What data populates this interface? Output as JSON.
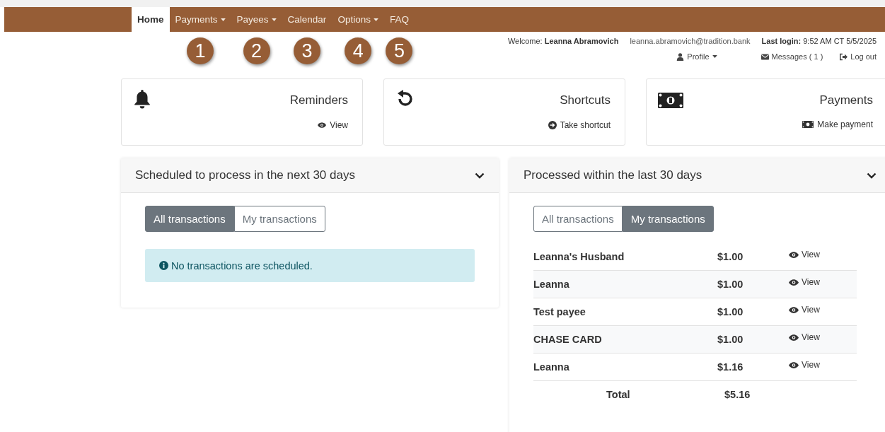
{
  "nav": {
    "items": [
      {
        "label": "Home",
        "selected": true,
        "dropdown": false
      },
      {
        "label": "Payments",
        "selected": false,
        "dropdown": true,
        "callout": "1"
      },
      {
        "label": "Payees",
        "selected": false,
        "dropdown": true,
        "callout": "2"
      },
      {
        "label": "Calendar",
        "selected": false,
        "dropdown": false,
        "callout": "3"
      },
      {
        "label": "Options",
        "selected": false,
        "dropdown": true,
        "callout": "4"
      },
      {
        "label": "FAQ",
        "selected": false,
        "dropdown": false,
        "callout": "5"
      }
    ]
  },
  "user": {
    "welcome_label": "Welcome:",
    "name": "Leanna Abramovich",
    "email": "leanna.abramovich@tradition.bank",
    "last_login_label": "Last login:",
    "last_login": "9:52 AM CT 5/5/2025",
    "links": [
      {
        "kind": "profile",
        "label": "Profile",
        "dropdown": true
      },
      {
        "kind": "messages",
        "label": "Messages ( 1 )",
        "dropdown": false
      },
      {
        "kind": "logout",
        "label": "Log out",
        "dropdown": false
      }
    ]
  },
  "cards": [
    {
      "kind": "reminders",
      "title": "Reminders",
      "link": "View"
    },
    {
      "kind": "shortcuts",
      "title": "Shortcuts",
      "link": "Take shortcut"
    },
    {
      "kind": "payments",
      "title": "Payments",
      "link": "Make payment"
    }
  ],
  "panels": [
    {
      "title": "Scheduled to process in the next 30 days",
      "expanded": true,
      "toggles": [
        {
          "label": "All transactions",
          "selected": true
        },
        {
          "label": "My transactions",
          "selected": false
        }
      ],
      "alert": "No transactions are scheduled."
    },
    {
      "title": "Processed within the last 30 days",
      "expanded": true,
      "toggles": [
        {
          "label": "All transactions",
          "selected": false
        },
        {
          "label": "My transactions",
          "selected": true
        }
      ],
      "rows": [
        {
          "payee": "Leanna's Husband",
          "amount": "$1.00",
          "action": "View"
        },
        {
          "payee": "Leanna",
          "amount": "$1.00",
          "action": "View"
        },
        {
          "payee": "Test payee",
          "amount": "$1.00",
          "action": "View"
        },
        {
          "payee": "CHASE CARD",
          "amount": "$1.00",
          "action": "View"
        },
        {
          "payee": "Leanna",
          "amount": "$1.16",
          "action": "View"
        }
      ],
      "total_label": "Total",
      "total": "$5.16"
    }
  ]
}
